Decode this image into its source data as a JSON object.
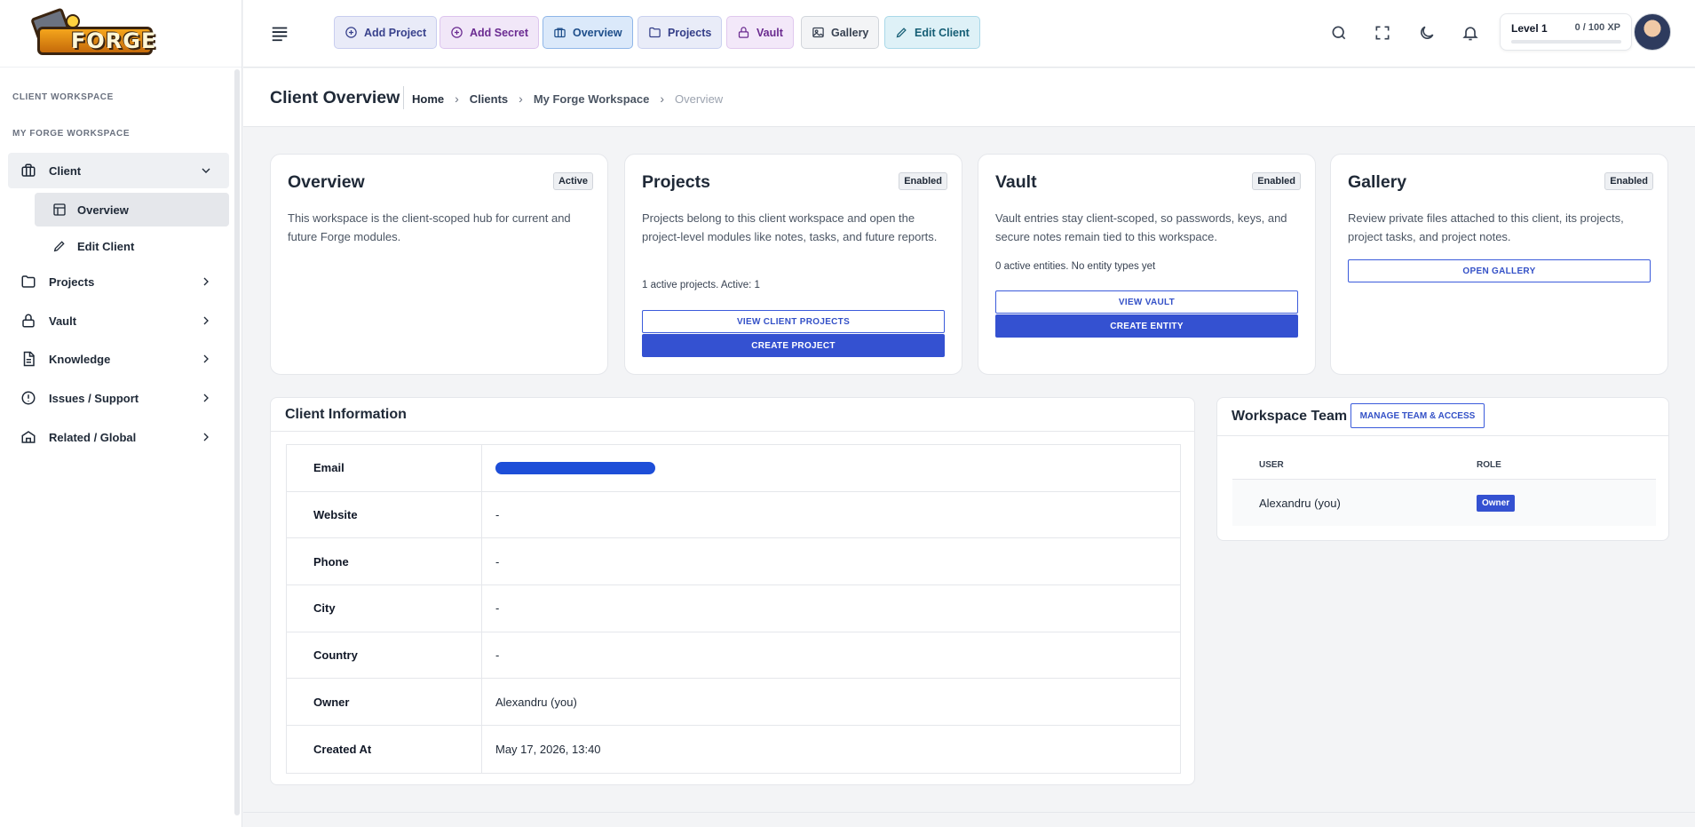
{
  "brand": {
    "logo_text": "FORGE"
  },
  "sidebar": {
    "section_workspace": "CLIENT WORKSPACE",
    "section_name": "MY FORGE WORKSPACE",
    "client": "Client",
    "sub_overview": "Overview",
    "sub_edit": "Edit Client",
    "projects": "Projects",
    "vault": "Vault",
    "knowledge": "Knowledge",
    "issues": "Issues / Support",
    "related": "Related / Global"
  },
  "toolbar": {
    "add_project": "Add Project",
    "add_secret": "Add Secret",
    "overview": "Overview",
    "projects": "Projects",
    "vault": "Vault",
    "gallery": "Gallery",
    "edit_client": "Edit Client"
  },
  "xp": {
    "level": "Level 1",
    "points": "0 / 100 XP",
    "progress": 0
  },
  "page": {
    "title": "Client Overview",
    "crumbs": [
      "Home",
      "Clients",
      "My Forge Workspace",
      "Overview"
    ]
  },
  "cards": {
    "overview": {
      "title": "Overview",
      "badge": "Active",
      "desc": "This workspace is the client-scoped hub for current and future Forge modules."
    },
    "projects": {
      "title": "Projects",
      "badge": "Enabled",
      "desc": "Projects belong to this client workspace and open the project-level modules like notes, tasks, and future reports.",
      "stat": "1 active projects. Active: 1",
      "btn1": "VIEW CLIENT PROJECTS",
      "btn2": "CREATE PROJECT"
    },
    "vault": {
      "title": "Vault",
      "badge": "Enabled",
      "desc": "Vault entries stay client-scoped, so passwords, keys, and secure notes remain tied to this workspace.",
      "stat": "0 active entities. No entity types yet",
      "btn1": "VIEW VAULT",
      "btn2": "CREATE ENTITY"
    },
    "gallery": {
      "title": "Gallery",
      "badge": "Enabled",
      "desc": "Review private files attached to this client, its projects, project tasks, and project notes.",
      "btn1": "OPEN GALLERY"
    }
  },
  "client_info": {
    "title": "Client Information",
    "rows": [
      {
        "key": "Email",
        "value": ""
      },
      {
        "key": "Website",
        "value": "-"
      },
      {
        "key": "Phone",
        "value": "-"
      },
      {
        "key": "City",
        "value": "-"
      },
      {
        "key": "Country",
        "value": "-"
      },
      {
        "key": "Owner",
        "value": "Alexandru (you)"
      },
      {
        "key": "Created At",
        "value": "May 17, 2026, 13:40"
      }
    ]
  },
  "team": {
    "title": "Workspace Team",
    "manage": "MANAGE TEAM & ACCESS",
    "col_user": "USER",
    "col_role": "ROLE",
    "members": [
      {
        "user": "Alexandru (you)",
        "role": "Owner"
      }
    ]
  },
  "colors": {
    "primary": "#3451d1",
    "redaction": "#1d4ed8"
  }
}
